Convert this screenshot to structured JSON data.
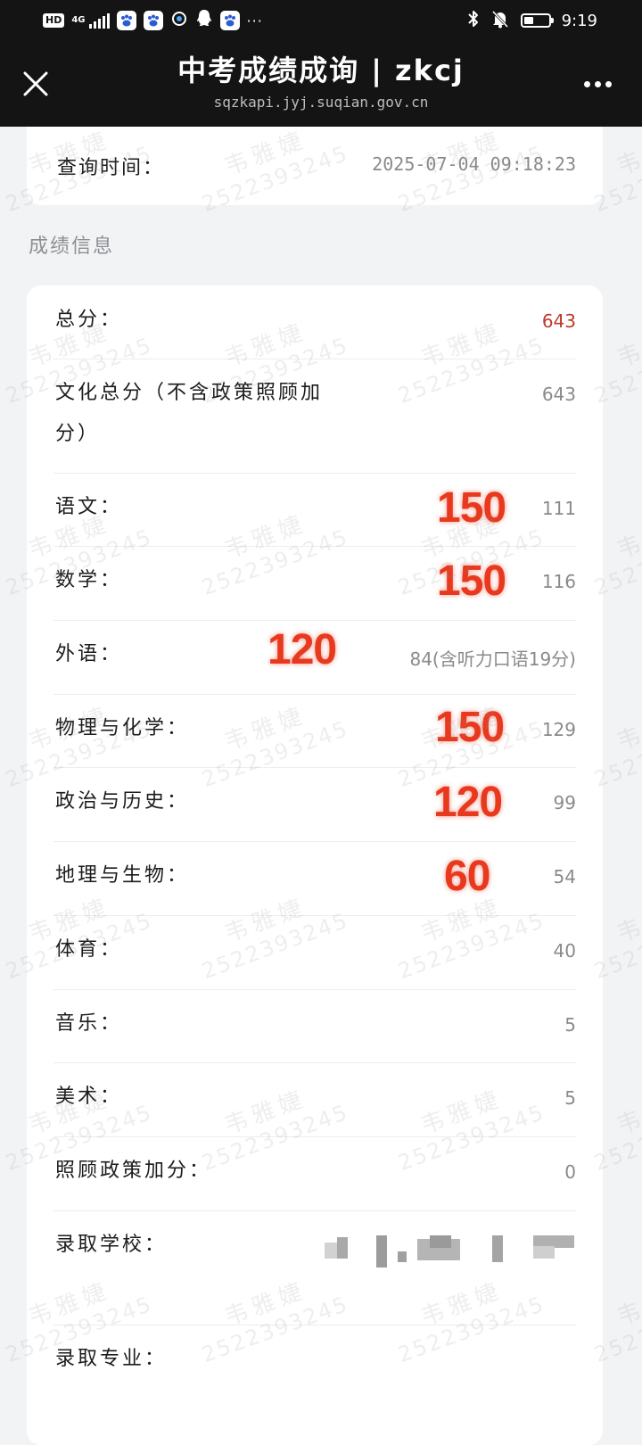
{
  "status_bar": {
    "hd": "HD",
    "network": "4G",
    "more_notifications": "···",
    "time": "9:19",
    "battery_level": 0.4
  },
  "title_bar": {
    "title": "中考成绩成询 | zkcj",
    "url": "sqzkapi.jyj.suqian.gov.cn"
  },
  "query": {
    "label": "查询时间：",
    "value": "2025-07-04 09:18:23"
  },
  "section_title": "成绩信息",
  "scores": {
    "total": {
      "label": "总分：",
      "value": "643"
    },
    "culture_total": {
      "label": "文化总分（不含政策照顾加分）",
      "value": "643"
    },
    "chinese": {
      "label": "语文：",
      "value": "111",
      "full_mark": "150"
    },
    "math": {
      "label": "数学：",
      "value": "116",
      "full_mark": "150"
    },
    "foreign": {
      "label": "外语：",
      "value": "84(含听力口语19分)",
      "full_mark": "120"
    },
    "physics_chem": {
      "label": "物理与化学：",
      "value": "129",
      "full_mark": "150"
    },
    "politics_history": {
      "label": "政治与历史：",
      "value": "99",
      "full_mark": "120"
    },
    "geo_bio": {
      "label": "地理与生物：",
      "value": "54",
      "full_mark": "60"
    },
    "pe": {
      "label": "体育：",
      "value": "40"
    },
    "music": {
      "label": "音乐：",
      "value": "5"
    },
    "art": {
      "label": "美术：",
      "value": "5"
    },
    "policy_bonus": {
      "label": "照顾政策加分：",
      "value": "0"
    }
  },
  "admission": {
    "school_label": "录取学校：",
    "major_label": "录取专业："
  },
  "watermark": {
    "name": "韦雅婕",
    "id": "2522393245"
  },
  "colors": {
    "header_bg": "#141414",
    "page_bg": "#f2f3f5",
    "total_score": "#c0392b",
    "annotation": "#e8391e"
  }
}
